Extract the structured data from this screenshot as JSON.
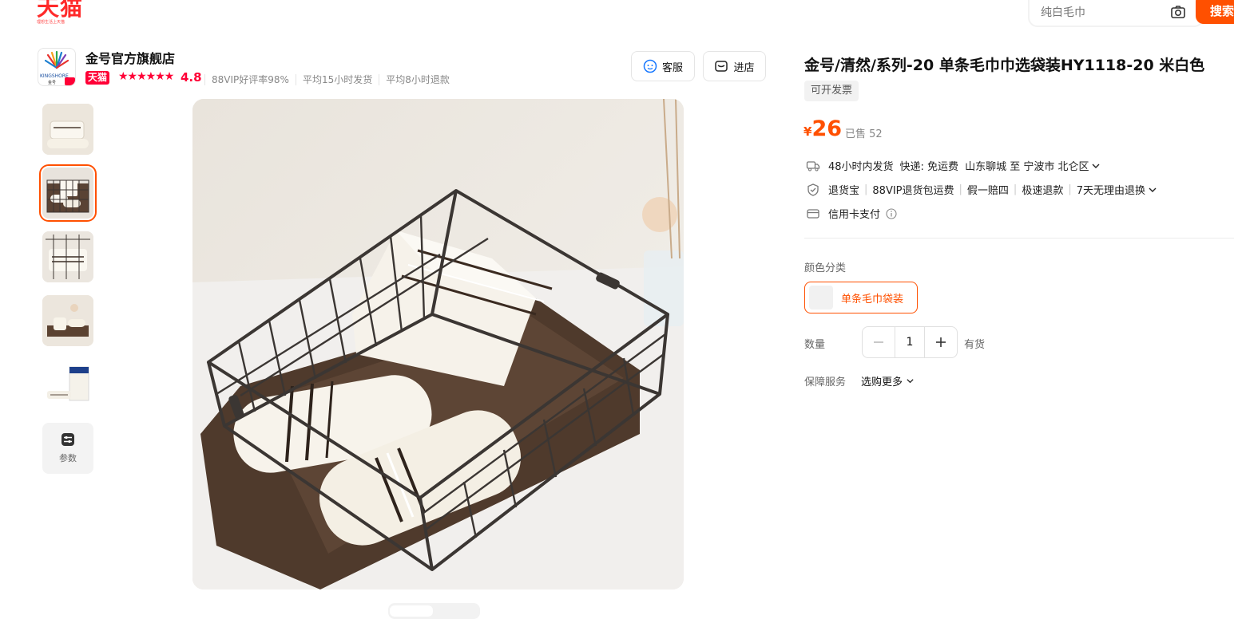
{
  "brand": {
    "logo_text": "天猫",
    "logo_sub": "理想生活上天猫",
    "color": "#ff2a2a"
  },
  "search": {
    "placeholder": "纯白毛巾",
    "button_label": "搜索",
    "accent": "#ff5000"
  },
  "store": {
    "logo_text": "KINGSHORE",
    "logo_text_cn": "金号",
    "name": "金号官方旗舰店",
    "badge": "天猫",
    "stars": "★★★★★★",
    "rating": "4.8",
    "stats": [
      "88VIP好评率98%",
      "平均15小时发货",
      "平均8小时退款"
    ],
    "service_button": "客服",
    "enter_shop_button": "进店"
  },
  "gallery": {
    "selected_index": 1,
    "params_label": "参数"
  },
  "product": {
    "title": "金号/清然/系列-20 单条毛巾巾选袋装HY1118-20 米白色",
    "invoice_tag": "可开发票",
    "price_symbol": "¥",
    "price": "26",
    "sold": "已售 52",
    "shipping": {
      "time": "48小时内发货",
      "express": "快递: 免运费",
      "route": "山东聊城 至 宁波市 北仑区"
    },
    "services": [
      "退货宝",
      "88VIP退货包运费",
      "假一赔四",
      "极速退款",
      "7天无理由退换"
    ],
    "payment": "信用卡支付",
    "color_label": "颜色分类",
    "sku_option": "单条毛巾袋装",
    "quantity_label": "数量",
    "quantity": "1",
    "stock": "有货",
    "guarantee_label": "保障服务",
    "guarantee_more": "选购更多"
  }
}
